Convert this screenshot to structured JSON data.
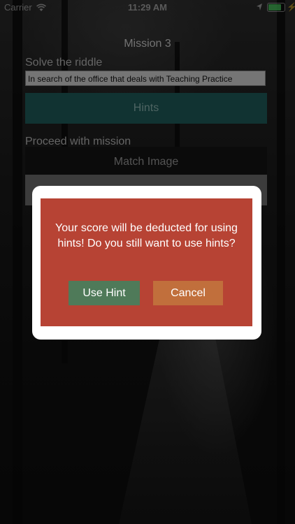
{
  "status_bar": {
    "carrier": "Carrier",
    "time": "11:29 AM",
    "battery_level": 0.9,
    "wifi_icon": "wifi-icon",
    "location_icon": "location-icon",
    "charging_icon": "bolt-icon"
  },
  "screen": {
    "title": "Mission 3",
    "riddle_label": "Solve the riddle",
    "riddle_text": "In search of the office that deals with Teaching Practice",
    "hints_label": "Hints",
    "proceed_label": "Proceed with mission",
    "match_image_label": "Match Image"
  },
  "dialog": {
    "message": "Your score will be deducted for using hints! Do you still want to use hints?",
    "use_hint_label": "Use Hint",
    "cancel_label": "Cancel"
  },
  "colors": {
    "dialog_bg": "#b74334",
    "use_hint_button": "#4f7a59",
    "cancel_button": "#c16f3c",
    "hints_button": "#1f5e5c"
  }
}
